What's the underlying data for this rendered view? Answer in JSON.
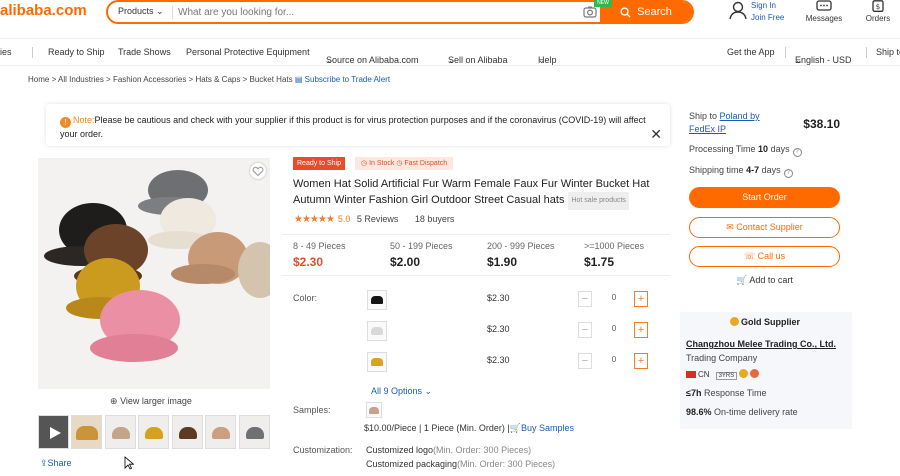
{
  "header": {
    "logo": "alibaba.com",
    "search": {
      "category": "Products",
      "placeholder": "What are you looking for...",
      "button": "Search",
      "new_tag": "NEW"
    },
    "signin": "Sign In",
    "join": "Join Free",
    "messages": "Messages",
    "orders": "Orders"
  },
  "nav": {
    "items": [
      "ies",
      "Ready to Ship",
      "Trade Shows",
      "Personal Protective Equipment",
      "Source on Alibaba.com",
      "Sell on Alibaba",
      "Help"
    ],
    "get_app": "Get the App",
    "lang": "English - USD",
    "ship_to": "Ship to"
  },
  "breadcrumb": {
    "items": [
      "Home",
      "All Industries",
      "Fashion Accessories",
      "Hats & Caps",
      "Bucket Hats"
    ],
    "alert": "Subscribe to Trade Alert"
  },
  "note": {
    "label": "Note:",
    "text": "Please be cautious and check with your supplier if this product is for virus protection purposes and if the coronavirus (COVID-19) will affect your order."
  },
  "gallery": {
    "view_larger": "View larger image",
    "share": "Share"
  },
  "product": {
    "ready_badge": "Ready to Ship",
    "in_stock": "In Stock",
    "fast_dispatch": "Fast Dispatch",
    "title": "Women Hat Solid Artificial Fur Warm Female Faux Fur Winter Bucket Hat Autumn Winter Fashion Girl Outdoor Street Casual hats",
    "hot_tag": "Hot sale products",
    "rating": 5.0,
    "rating_text": "5.0",
    "reviews": "5 Reviews",
    "buyers": "18 buyers",
    "tiers": [
      {
        "qty": "8 - 49 Pieces",
        "price": "$2.30"
      },
      {
        "qty": "50 - 199 Pieces",
        "price": "$2.00"
      },
      {
        "qty": "200 - 999 Pieces",
        "price": "$1.90"
      },
      {
        "qty": ">=1000 Pieces",
        "price": "$1.75"
      }
    ],
    "color_label": "Color:",
    "variants": [
      {
        "price": "$2.30",
        "qty": "0",
        "color": "#151515"
      },
      {
        "price": "$2.30",
        "qty": "0",
        "color": "#d9d9d9"
      },
      {
        "price": "$2.30",
        "qty": "0",
        "color": "#d8a41a"
      }
    ],
    "all_options": "All 9 Options",
    "samples_label": "Samples:",
    "sample_price": "$10.00/Piece | 1 Piece (Min. Order) |",
    "buy_samples": "Buy Samples",
    "customization_label": "Customization:",
    "custom_logo": "Customized logo",
    "custom_logo_min": "(Min. Order: 300 Pieces)",
    "custom_pack": "Customized packaging",
    "custom_pack_min": "(Min. Order: 300 Pieces)"
  },
  "shipping": {
    "ship_to_prefix": "Ship to",
    "country": "Poland by",
    "carrier": "FedEx IP",
    "price": "$38.10",
    "processing_label": "Processing Time",
    "processing_value": "10",
    "processing_unit": "days",
    "shipping_label": "Shipping time",
    "shipping_value": "4-7",
    "shipping_unit": "days",
    "start_order": "Start Order",
    "contact": "Contact Supplier",
    "call": "Call us",
    "add_cart": "Add to cart"
  },
  "supplier": {
    "gold": "Gold Supplier",
    "name": "Changzhou Melee Trading Co., Ltd.",
    "type": "Trading Company",
    "country": "CN",
    "years": "3YRS",
    "response_value": "≤7h",
    "response_label": "Response Time",
    "delivery_value": "98.6%",
    "delivery_label": "On-time delivery rate"
  },
  "colors": {
    "accent": "#ff6a00",
    "link": "#1a5cb8",
    "red": "#e94c2c"
  }
}
